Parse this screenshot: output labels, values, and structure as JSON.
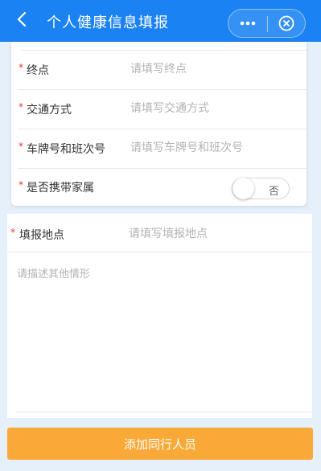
{
  "header": {
    "title": "个人健康信息填报",
    "back_icon": "chevron-left-icon",
    "more_icon": "more-dots-icon",
    "close_icon": "close-circle-icon",
    "color": "#1a82f2"
  },
  "travel_form": {
    "required_mark": "*",
    "fields": [
      {
        "label": "终点",
        "placeholder": "请填写终点"
      },
      {
        "label": "交通方式",
        "placeholder": "请填写交通方式"
      },
      {
        "label": "车牌号和班次号",
        "placeholder": "请填写车牌号和班次号"
      }
    ],
    "family_toggle": {
      "label": "是否携带家属",
      "state_text": "否",
      "on": false
    }
  },
  "report_form": {
    "location": {
      "label": "填报地点",
      "placeholder": "请填写填报地点"
    },
    "description_placeholder": "请描述其他情形"
  },
  "actions": {
    "add_companion_label": "添加同行人员",
    "button_color": "#f9a937"
  }
}
